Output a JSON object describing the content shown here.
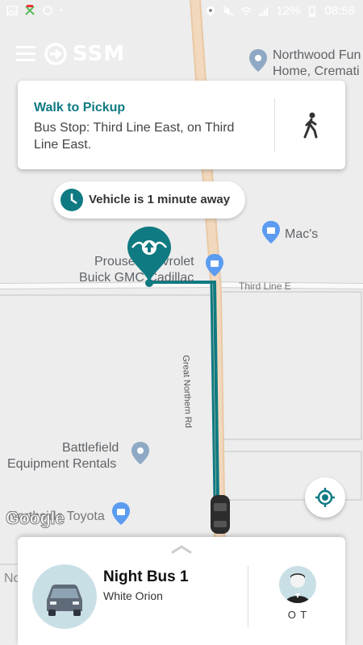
{
  "status_bar": {
    "battery": "12%",
    "time": "08:58"
  },
  "app": {
    "brand": "SSM"
  },
  "instruction_card": {
    "title": "Walk to Pickup",
    "description": "Bus Stop: Third Line East, on Third Line East.",
    "icon": "walking-person-icon"
  },
  "eta_pill": {
    "text": "Vehicle is 1 minute away",
    "icon": "clock-icon"
  },
  "map": {
    "labels": {
      "northwood": "Northwood Fun",
      "northwood_2": "Home, Cremati",
      "macs": "Mac's",
      "prouse_1": "Prouse Chevrolet",
      "prouse_2": "Buick GMC Cadillac",
      "third_line": "Third Line E",
      "great_northern": "Great Northern Rd",
      "battlefield_1": "Battlefield",
      "battlefield_2": "Equipment Rentals",
      "toyota": "Northside Toyota",
      "cut_left": "No",
      "google": "Google"
    },
    "route_color": "#0f7a82",
    "pin_color": "#0f7a82"
  },
  "vehicle_panel": {
    "name": "Night Bus 1",
    "description": "White Orion",
    "driver_initials": "O T"
  }
}
